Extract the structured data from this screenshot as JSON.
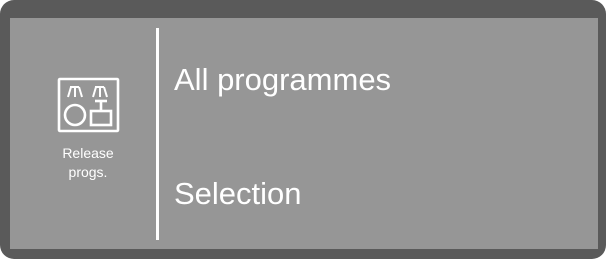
{
  "colors": {
    "bezel": "#5a5a5a",
    "screen_background": "#969696",
    "foreground": "#ffffff"
  },
  "sidebar": {
    "icon": "release-programmes-icon",
    "label_line1": "Release",
    "label_line2": "progs."
  },
  "menu": {
    "items": [
      {
        "label": "All programmes"
      },
      {
        "label": "Selection"
      }
    ]
  }
}
